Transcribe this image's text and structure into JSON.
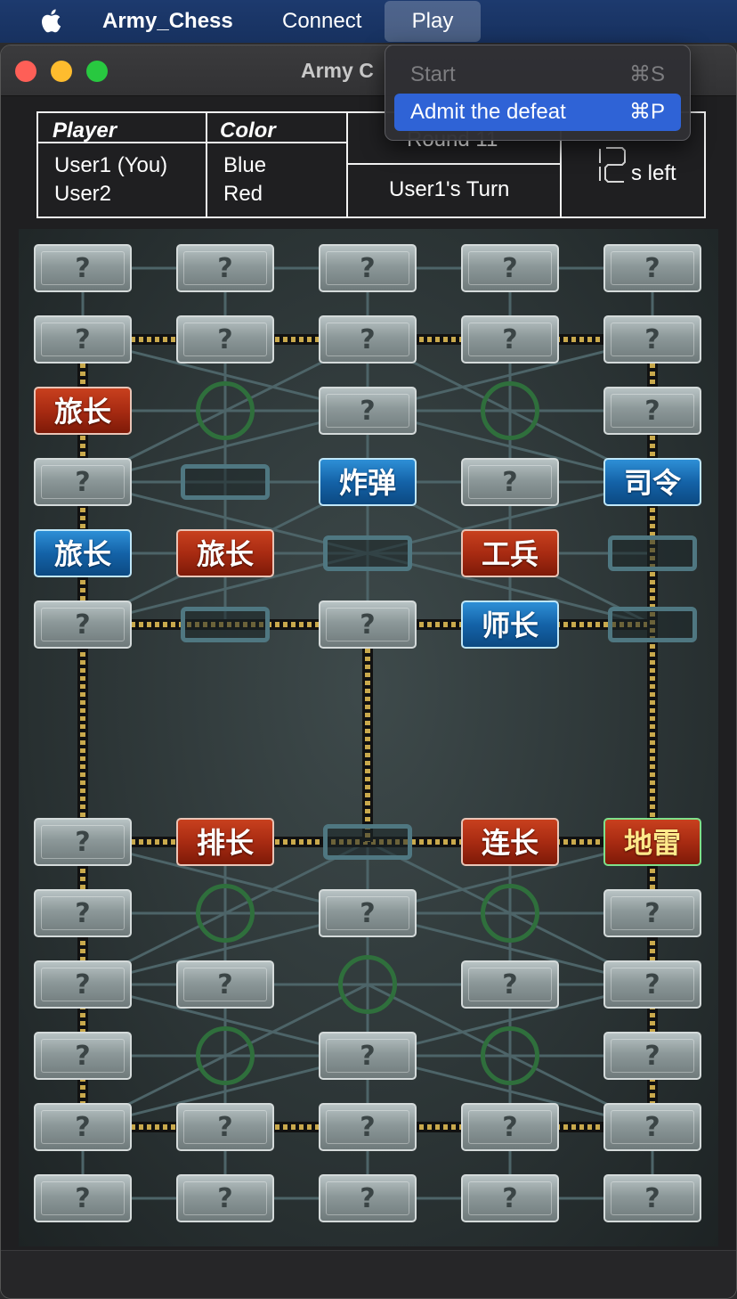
{
  "menubar": {
    "app_name": "Army_Chess",
    "connect": "Connect",
    "play": "Play"
  },
  "window": {
    "title": "Army C"
  },
  "play_menu": {
    "items": [
      {
        "label": "Start",
        "shortcut": "⌘S",
        "enabled": false
      },
      {
        "label": "Admit the defeat",
        "shortcut": "⌘P",
        "enabled": true,
        "highlighted": true
      }
    ]
  },
  "info": {
    "player_header": "Player",
    "color_header": "Color",
    "players": [
      {
        "name": "User1 (You)",
        "color": "Blue"
      },
      {
        "name": "User2",
        "color": "Red"
      }
    ],
    "round_text": "Round 11",
    "turn_text": "User1's Turn",
    "timer_value": "12",
    "timer_suffix": "s left"
  },
  "board": {
    "hidden_label": "?",
    "pieces": [
      {
        "row": 0,
        "col": 0,
        "side": "hidden"
      },
      {
        "row": 0,
        "col": 1,
        "side": "hidden"
      },
      {
        "row": 0,
        "col": 2,
        "side": "hidden"
      },
      {
        "row": 0,
        "col": 3,
        "side": "hidden"
      },
      {
        "row": 0,
        "col": 4,
        "side": "hidden"
      },
      {
        "row": 1,
        "col": 0,
        "side": "hidden"
      },
      {
        "row": 1,
        "col": 1,
        "side": "hidden"
      },
      {
        "row": 1,
        "col": 2,
        "side": "hidden"
      },
      {
        "row": 1,
        "col": 3,
        "side": "hidden"
      },
      {
        "row": 1,
        "col": 4,
        "side": "hidden"
      },
      {
        "row": 2,
        "col": 0,
        "side": "red",
        "label": "旅长"
      },
      {
        "row": 2,
        "col": 2,
        "side": "hidden"
      },
      {
        "row": 2,
        "col": 4,
        "side": "hidden"
      },
      {
        "row": 3,
        "col": 0,
        "side": "hidden"
      },
      {
        "row": 3,
        "col": 2,
        "side": "blue",
        "label": "炸弹"
      },
      {
        "row": 3,
        "col": 3,
        "side": "hidden"
      },
      {
        "row": 3,
        "col": 4,
        "side": "blue",
        "label": "司令"
      },
      {
        "row": 4,
        "col": 0,
        "side": "blue",
        "label": "旅长"
      },
      {
        "row": 4,
        "col": 1,
        "side": "red",
        "label": "旅长"
      },
      {
        "row": 4,
        "col": 3,
        "side": "red",
        "label": "工兵"
      },
      {
        "row": 5,
        "col": 0,
        "side": "hidden"
      },
      {
        "row": 5,
        "col": 2,
        "side": "hidden"
      },
      {
        "row": 5,
        "col": 3,
        "side": "blue",
        "label": "师长"
      },
      {
        "row": 6,
        "col": 0,
        "side": "hidden"
      },
      {
        "row": 6,
        "col": 1,
        "side": "red",
        "label": "排长"
      },
      {
        "row": 6,
        "col": 3,
        "side": "red",
        "label": "连长"
      },
      {
        "row": 6,
        "col": 4,
        "side": "red",
        "label": "地雷",
        "mine": true
      },
      {
        "row": 7,
        "col": 0,
        "side": "hidden"
      },
      {
        "row": 7,
        "col": 2,
        "side": "hidden"
      },
      {
        "row": 7,
        "col": 4,
        "side": "hidden"
      },
      {
        "row": 8,
        "col": 0,
        "side": "hidden"
      },
      {
        "row": 8,
        "col": 1,
        "side": "hidden"
      },
      {
        "row": 8,
        "col": 3,
        "side": "hidden"
      },
      {
        "row": 8,
        "col": 4,
        "side": "hidden"
      },
      {
        "row": 9,
        "col": 0,
        "side": "hidden"
      },
      {
        "row": 9,
        "col": 2,
        "side": "hidden"
      },
      {
        "row": 9,
        "col": 4,
        "side": "hidden"
      },
      {
        "row": 10,
        "col": 0,
        "side": "hidden"
      },
      {
        "row": 10,
        "col": 1,
        "side": "hidden"
      },
      {
        "row": 10,
        "col": 2,
        "side": "hidden"
      },
      {
        "row": 10,
        "col": 3,
        "side": "hidden"
      },
      {
        "row": 10,
        "col": 4,
        "side": "hidden"
      },
      {
        "row": 11,
        "col": 0,
        "side": "hidden"
      },
      {
        "row": 11,
        "col": 1,
        "side": "hidden"
      },
      {
        "row": 11,
        "col": 2,
        "side": "hidden"
      },
      {
        "row": 11,
        "col": 3,
        "side": "hidden"
      },
      {
        "row": 11,
        "col": 4,
        "side": "hidden"
      }
    ],
    "empty_posts": [
      {
        "row": 3,
        "col": 1
      },
      {
        "row": 4,
        "col": 2
      },
      {
        "row": 4,
        "col": 4
      },
      {
        "row": 5,
        "col": 1
      },
      {
        "row": 5,
        "col": 4
      },
      {
        "row": 6,
        "col": 2
      }
    ],
    "camps": [
      {
        "row": 2,
        "col": 1
      },
      {
        "row": 2,
        "col": 3
      },
      {
        "row": 7,
        "col": 1
      },
      {
        "row": 7,
        "col": 3
      },
      {
        "row": 8,
        "col": 2
      },
      {
        "row": 9,
        "col": 1
      },
      {
        "row": 9,
        "col": 3
      }
    ]
  },
  "colors": {
    "menubar": "#1d3a6e",
    "menu_highlight": "#2f63d6",
    "red_piece": "#a82b12",
    "blue_piece": "#1463a8",
    "camp_ring": "#2f6f3c"
  }
}
